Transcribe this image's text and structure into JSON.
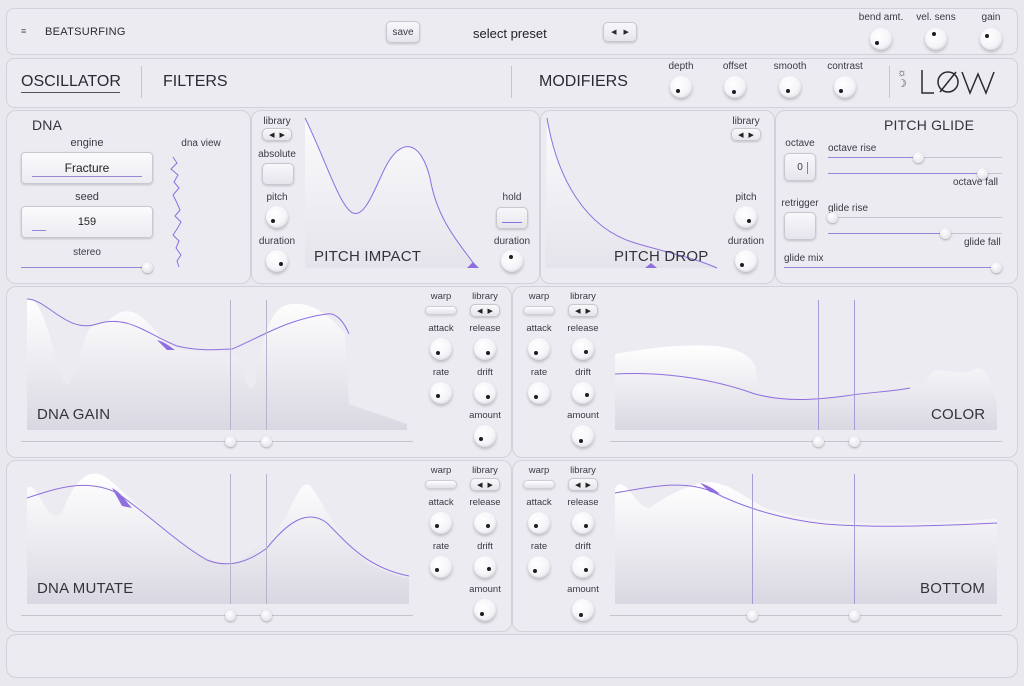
{
  "topbar": {
    "menu_icon": "hamburger-icon",
    "brand": "BEATSURFING",
    "save_label": "save",
    "preset_label": "select preset",
    "knobs": [
      {
        "label": "bend amt."
      },
      {
        "label": "vel. sens"
      },
      {
        "label": "gain"
      }
    ]
  },
  "tabs": {
    "oscillator": "OSCILLATOR",
    "filters": "FILTERS",
    "modifiers": "MODIFIERS",
    "mod_knobs": [
      {
        "label": "depth"
      },
      {
        "label": "offset"
      },
      {
        "label": "smooth"
      },
      {
        "label": "contrast"
      }
    ],
    "logo_text": "LOW",
    "theme_icon": "sun-moon-icon"
  },
  "dna": {
    "title": "DNA",
    "engine_label": "engine",
    "engine_value": "Fracture",
    "seed_label": "seed",
    "seed_value": "159",
    "stereo_label": "stereo",
    "dna_view_label": "dna view"
  },
  "pitch_impact": {
    "library_label": "library",
    "absolute_label": "absolute",
    "pitch_label": "pitch",
    "duration_label": "duration",
    "title": "PITCH IMPACT",
    "hold_label": "hold",
    "hold_duration_label": "duration"
  },
  "pitch_drop": {
    "library_label": "library",
    "title": "PITCH DROP",
    "pitch_label": "pitch",
    "duration_label": "duration"
  },
  "pitch_glide": {
    "title": "PITCH GLIDE",
    "octave_label": "octave",
    "octave_value": "0",
    "octave_rise_label": "octave rise",
    "octave_fall_label": "octave fall",
    "retrigger_label": "retrigger",
    "glide_rise_label": "glide rise",
    "glide_fall_label": "glide fall",
    "glide_mix_label": "glide mix"
  },
  "mod_panels": [
    {
      "title": "DNA GAIN"
    },
    {
      "title": "COLOR"
    },
    {
      "title": "DNA MUTATE"
    },
    {
      "title": "BOTTOM"
    }
  ],
  "mod_controls": {
    "warp": "warp",
    "library": "library",
    "attack": "attack",
    "release": "release",
    "rate": "rate",
    "drift": "drift",
    "amount": "amount"
  },
  "colors": {
    "accent": "#8e6fe0",
    "panel": "#ecebf1",
    "background": "#e9e8ee"
  }
}
